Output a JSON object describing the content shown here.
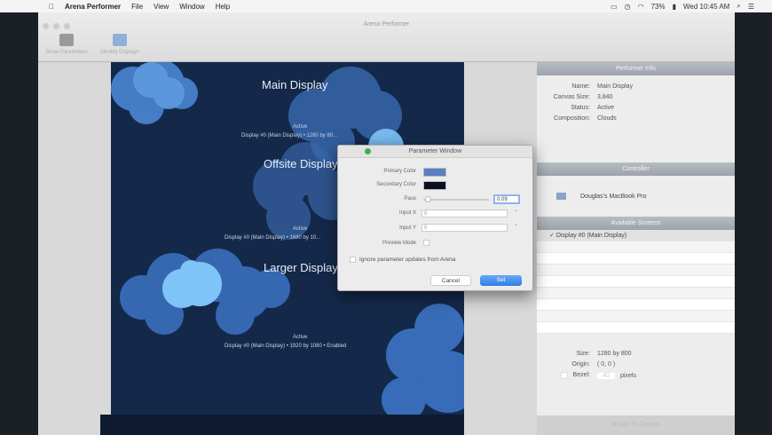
{
  "menubar": {
    "app": "Arena Performer",
    "items": [
      "File",
      "View",
      "Window",
      "Help"
    ],
    "battery": "73%",
    "clock": "Wed 10:45 AM"
  },
  "window": {
    "title": "Arena Performer",
    "toolbar": [
      {
        "label": "Show Parameters",
        "icon": "parameters-icon"
      },
      {
        "label": "Identify Displays",
        "icon": "display-icon"
      }
    ]
  },
  "canvas": {
    "displays": [
      {
        "title": "Main Display",
        "status": "Active",
        "details": "Display #0  (Main Display)   •   1280 by 80..."
      },
      {
        "title": "Offsite Display",
        "status": "Active",
        "details": "Display #0  (Main Display)   •   1680 by 10..."
      },
      {
        "title": "Larger Display",
        "status": "Active",
        "details": "Display #0  (Main Display)   •   1920 by 1080   •   Enabled"
      }
    ]
  },
  "dialog": {
    "title": "Parameter Window",
    "primary_color_label": "Primary Color",
    "primary_color": "#5b7fc0",
    "secondary_color_label": "Secondary Color",
    "secondary_color": "#0a0f1e",
    "pace_label": "Pace",
    "pace_value": "0.09",
    "input_x_label": "Input X",
    "input_x_value": "0",
    "input_y_label": "Input Y",
    "input_y_value": "0",
    "preview_mode_label": "Preview Mode",
    "ignore_label": "Ignore parameter updates from Arena",
    "cancel": "Cancel",
    "set": "Set"
  },
  "panel": {
    "performer_info_header": "Performer Info",
    "info": [
      {
        "k": "Name:",
        "v": "Main Display"
      },
      {
        "k": "Canvas Size:",
        "v": "3,840"
      },
      {
        "k": "Status:",
        "v": "Active"
      },
      {
        "k": "Composition:",
        "v": "Clouds"
      }
    ],
    "controller_header": "Controller",
    "controller": "Douglas's MacBook Pro",
    "screens_header": "Available Screens",
    "screens": [
      "Display #0  (Main Display)"
    ],
    "size_label": "Size:",
    "size": "1280 by 800",
    "origin_label": "Origin:",
    "origin": "( 0, 0 )",
    "bezel_label": "Bezel:",
    "bezel_value": "40",
    "bezel_unit": "pixels",
    "add_button": "Add To Canvas"
  }
}
